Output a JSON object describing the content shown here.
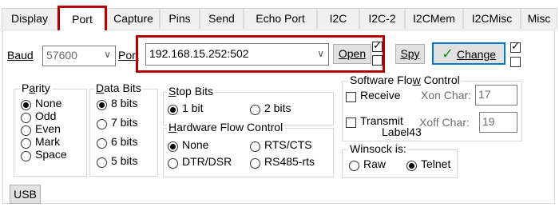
{
  "tabs": [
    "Display",
    "Port",
    "Capture",
    "Pins",
    "Send",
    "Echo Port",
    "I2C",
    "I2C-2",
    "I2CMem",
    "I2CMisc",
    "Misc"
  ],
  "port": {
    "baud_label": "Baud",
    "baud_value": "57600",
    "port_label": "Port",
    "port_value": "192.168.15.252:502",
    "open_label": "Open",
    "spy_label": "Spy",
    "change_label": "Change"
  },
  "parity": {
    "title": "Parity",
    "options": [
      "None",
      "Odd",
      "Even",
      "Mark",
      "Space"
    ]
  },
  "databits": {
    "title": "Data Bits",
    "options": [
      "8 bits",
      "7 bits",
      "6 bits",
      "5 bits"
    ]
  },
  "stopbits": {
    "title": "Stop Bits",
    "options": [
      "1 bit",
      "2 bits"
    ]
  },
  "hwflow": {
    "title": "Hardware Flow Control",
    "options": [
      "None",
      "RTS/CTS",
      "DTR/DSR",
      "RS485-rts"
    ]
  },
  "swflow": {
    "title": "Software Flow Control",
    "receive": "Receive",
    "transmit": "Transmit",
    "xon_label": "Xon Char:",
    "xon_value": "17",
    "xoff_label": "Xoff Char:",
    "xoff_value": "19"
  },
  "label43": "Label43",
  "winsock": {
    "title": "Winsock is:",
    "options": [
      "Raw",
      "Telnet"
    ]
  },
  "usb_label": "USB",
  "colors": {
    "highlight": "#b30000",
    "accent": "#0078d7",
    "check_green": "#1a8f1a"
  }
}
